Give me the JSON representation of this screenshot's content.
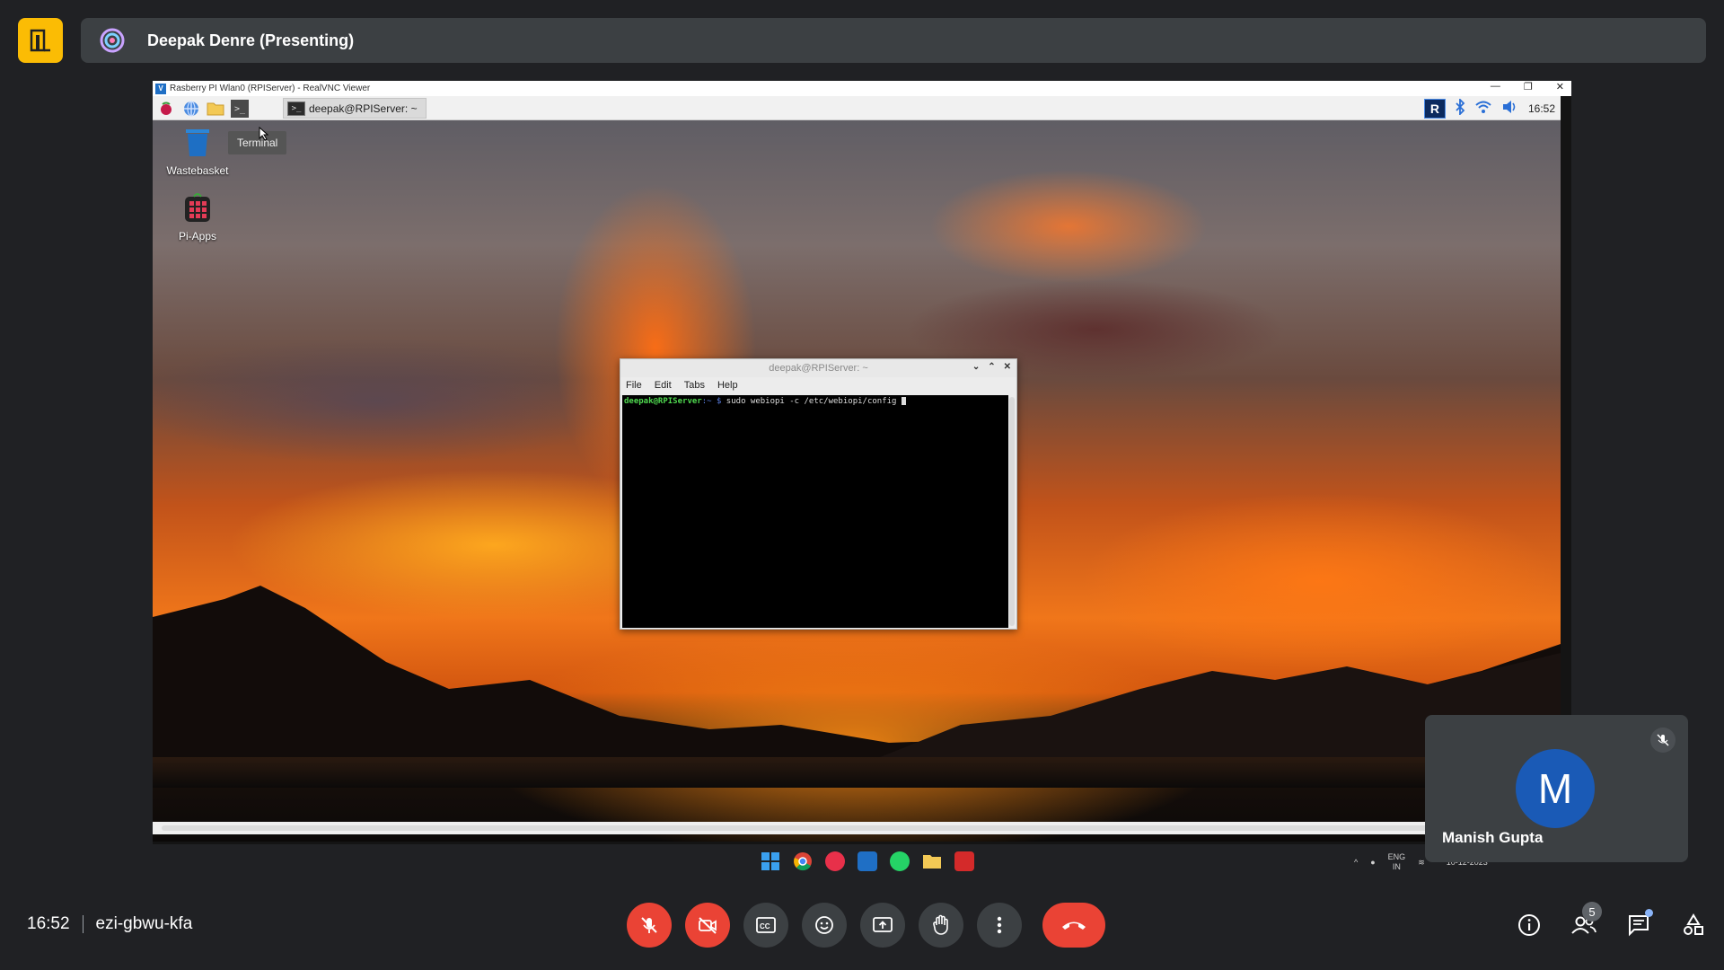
{
  "meet": {
    "presenter_label": "Deepak Denre (Presenting)",
    "time": "16:52",
    "meeting_code": "ezi-gbwu-kfa",
    "participant_count": "5",
    "participant": {
      "initial": "M",
      "name": "Manish Gupta",
      "avatar_color": "#1a5ab6"
    },
    "controls": [
      "mic-off",
      "camera-off",
      "captions",
      "emoji",
      "present",
      "raise-hand",
      "more",
      "end-call"
    ],
    "end_call_color": "#ea4335"
  },
  "vnc": {
    "window_title": "Rasberry PI Wlan0 (RPIServer) - RealVNC Viewer",
    "panel": {
      "task_label": "deepak@RPIServer: ~",
      "clock": "16:52",
      "tooltip": "Terminal"
    },
    "desktop_icons": [
      {
        "label": "Wastebasket"
      },
      {
        "label": "Pi-Apps"
      }
    ],
    "terminal": {
      "title": "deepak@RPIServer: ~",
      "menu": [
        "File",
        "Edit",
        "Tabs",
        "Help"
      ],
      "prompt_user": "deepak@RPIServer",
      "prompt_path": ":~ $",
      "command": " sudo webiopi -c /etc/webiopi/config "
    }
  },
  "windows_taskbar": {
    "lang_top": "ENG",
    "lang_bottom": "IN",
    "date": "10-12-2023"
  }
}
